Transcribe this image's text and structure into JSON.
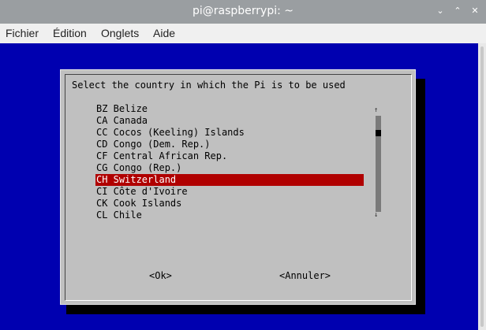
{
  "window": {
    "title": "pi@raspberrypi: ~"
  },
  "titlebar_buttons": {
    "minimize": "⌄",
    "maximize": "⌃",
    "close": "✕"
  },
  "menu": [
    "Fichier",
    "Édition",
    "Onglets",
    "Aide"
  ],
  "dialog": {
    "prompt": "Select the country in which the Pi is to be used",
    "items": [
      "BZ Belize",
      "CA Canada",
      "CC Cocos (Keeling) Islands",
      "CD Congo (Dem. Rep.)",
      "CF Central African Rep.",
      "CG Congo (Rep.)",
      "CH Switzerland",
      "CI Côte d'Ivoire",
      "CK Cook Islands",
      "CL Chile"
    ],
    "selected_index": 6,
    "scroll_up": "↑",
    "scroll_down": "↓",
    "ok_label": "<Ok>",
    "cancel_label": "<Annuler>"
  },
  "colors": {
    "terminal_bg": "#0000b0",
    "dialog_bg": "#c0c0c0",
    "selection": "#b00000",
    "titlebar": "#9a9ea1"
  }
}
